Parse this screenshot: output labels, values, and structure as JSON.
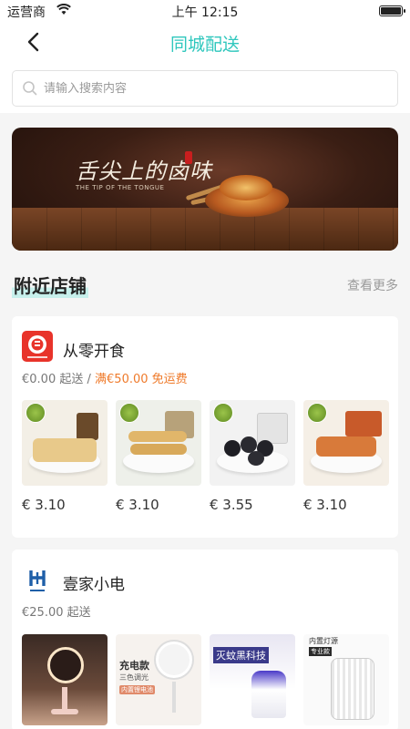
{
  "status_bar": {
    "carrier": "运营商",
    "time": "上午 12:15"
  },
  "nav": {
    "title": "同城配送"
  },
  "search": {
    "placeholder": "请输入搜索内容"
  },
  "banner": {
    "headline": "舌尖上的卤味",
    "subline": "THE TIP OF THE TONGUE"
  },
  "section": {
    "title": "附近店铺",
    "more": "查看更多"
  },
  "stores": [
    {
      "name": "从零开食",
      "min_order": "€0.00 起送",
      "separator": "/",
      "free_shipping": "满€50.00 免运费",
      "products": [
        {
          "price": "€ 3.10"
        },
        {
          "price": "€ 3.10"
        },
        {
          "price": "€ 3.55"
        },
        {
          "price": "€ 3.10"
        }
      ]
    },
    {
      "name": "壹家小电",
      "min_order": "€25.00 起送",
      "products": [
        {
          "tag1": "",
          "tag2": ""
        },
        {
          "tag1": "充电款",
          "tag2": "三色调光",
          "tag3": "内置锂电池"
        },
        {
          "tag1": "灭蚊黑科技",
          "tag2": ""
        },
        {
          "tag1": "内置灯源",
          "tag2": "专业款"
        }
      ]
    }
  ],
  "colors": {
    "accent": "#2fc7bd",
    "promo": "#ef7a2a",
    "muted": "#9a9a9a"
  }
}
